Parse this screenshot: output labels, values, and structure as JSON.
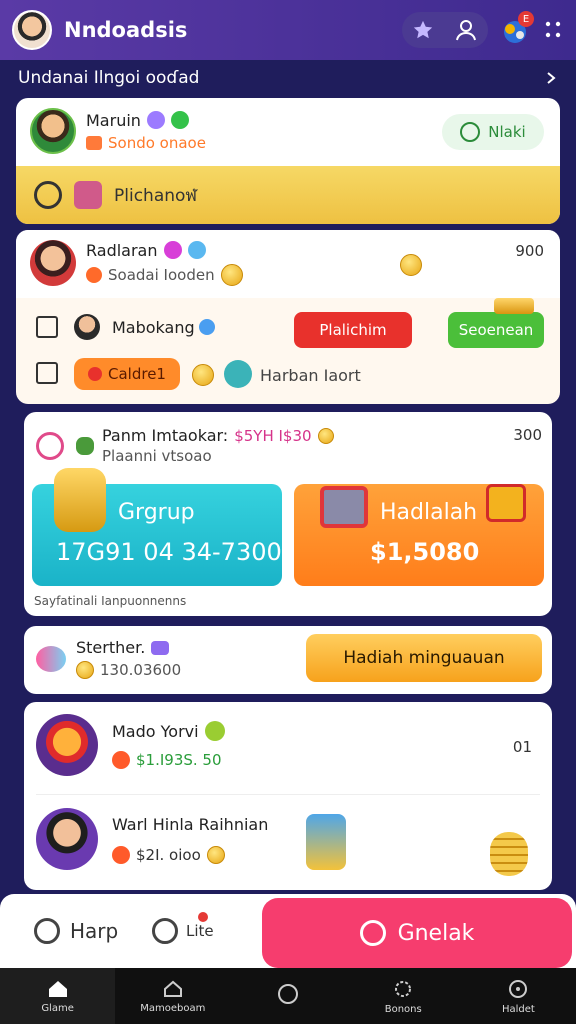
{
  "header": {
    "title": "Nndoadsis",
    "subtitle": "Undanai Ilngoi ooɗad"
  },
  "card_top": {
    "name": "Maruin",
    "sub": "Sondo onaoe",
    "button": "Nlaki",
    "banner": "Plichanoฬ"
  },
  "card_two": {
    "name": "Radlaran",
    "sub": "Soadai Iooden",
    "value": "900",
    "row1_name": "Mabokang",
    "row1_btn_red": "Plalichim",
    "row1_btn_green": "Seoenean",
    "row2_btn": "Caldre1",
    "row2_text": "Harban Iaort"
  },
  "card_three": {
    "name": "Panm Imtaokar:",
    "price": "$5YH I$30",
    "sub": "Plaanni vtsoao",
    "value": "300",
    "tile1_title": "Grgrup",
    "tile1_value": "17G91 04 34-7300",
    "tile2_title": "Hadlalah",
    "tile2_value": "$1,5080",
    "footer": "Sayfatinali Ianpuonnenns"
  },
  "card_four": {
    "name": "Sterther.",
    "sub": "130.03600",
    "button": "Hadiah minguauan"
  },
  "card_five": {
    "item1_name": "Mado Yorvi",
    "item1_value": "$1.I93S. 50",
    "item1_count": "01",
    "item2_name": "Warl Hinla Raihnian",
    "item2_value": "$2I. oioo"
  },
  "action_bar": {
    "left_label": "Harp",
    "mid_label": "Lite",
    "primary": "Gnelak"
  },
  "nav": {
    "items": [
      "Glame",
      "Mamoeboam",
      "",
      "Bonons",
      "Haldet"
    ]
  },
  "colors": {
    "accent": "#5a3aa6",
    "banner": "#f3cf58",
    "teal": "#27c7d3",
    "orange": "#ff8a1f",
    "primary_cta": "#f63d6e"
  }
}
